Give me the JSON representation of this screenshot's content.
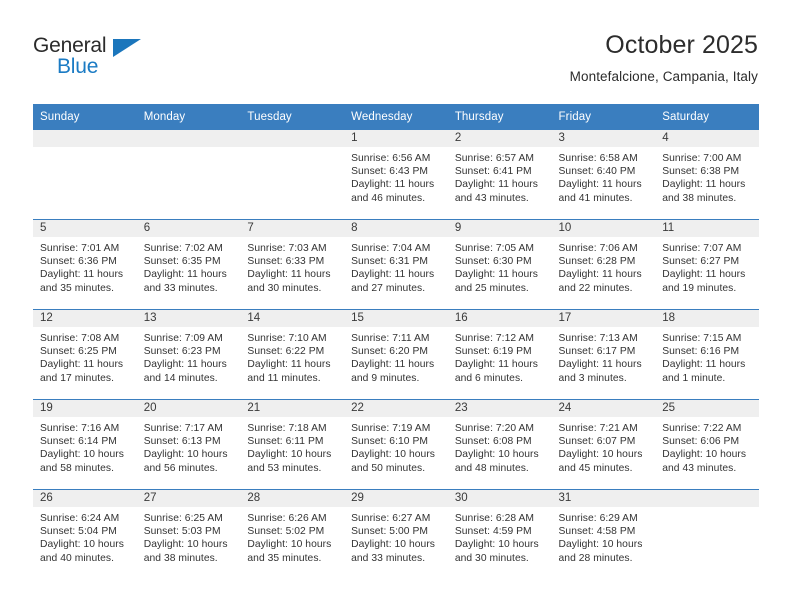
{
  "brand": {
    "name_part1": "General",
    "name_part2": "Blue",
    "accent_color": "#1b76bc"
  },
  "header": {
    "title": "October 2025",
    "location": "Montefalcione, Campania, Italy"
  },
  "calendar": {
    "header_bg": "#3a7ebf",
    "daynum_bg": "#efefef",
    "weekdays": [
      "Sunday",
      "Monday",
      "Tuesday",
      "Wednesday",
      "Thursday",
      "Friday",
      "Saturday"
    ],
    "weeks": [
      [
        {
          "day": "",
          "lines": []
        },
        {
          "day": "",
          "lines": []
        },
        {
          "day": "",
          "lines": []
        },
        {
          "day": "1",
          "lines": [
            "Sunrise: 6:56 AM",
            "Sunset: 6:43 PM",
            "Daylight: 11 hours",
            "and 46 minutes."
          ]
        },
        {
          "day": "2",
          "lines": [
            "Sunrise: 6:57 AM",
            "Sunset: 6:41 PM",
            "Daylight: 11 hours",
            "and 43 minutes."
          ]
        },
        {
          "day": "3",
          "lines": [
            "Sunrise: 6:58 AM",
            "Sunset: 6:40 PM",
            "Daylight: 11 hours",
            "and 41 minutes."
          ]
        },
        {
          "day": "4",
          "lines": [
            "Sunrise: 7:00 AM",
            "Sunset: 6:38 PM",
            "Daylight: 11 hours",
            "and 38 minutes."
          ]
        }
      ],
      [
        {
          "day": "5",
          "lines": [
            "Sunrise: 7:01 AM",
            "Sunset: 6:36 PM",
            "Daylight: 11 hours",
            "and 35 minutes."
          ]
        },
        {
          "day": "6",
          "lines": [
            "Sunrise: 7:02 AM",
            "Sunset: 6:35 PM",
            "Daylight: 11 hours",
            "and 33 minutes."
          ]
        },
        {
          "day": "7",
          "lines": [
            "Sunrise: 7:03 AM",
            "Sunset: 6:33 PM",
            "Daylight: 11 hours",
            "and 30 minutes."
          ]
        },
        {
          "day": "8",
          "lines": [
            "Sunrise: 7:04 AM",
            "Sunset: 6:31 PM",
            "Daylight: 11 hours",
            "and 27 minutes."
          ]
        },
        {
          "day": "9",
          "lines": [
            "Sunrise: 7:05 AM",
            "Sunset: 6:30 PM",
            "Daylight: 11 hours",
            "and 25 minutes."
          ]
        },
        {
          "day": "10",
          "lines": [
            "Sunrise: 7:06 AM",
            "Sunset: 6:28 PM",
            "Daylight: 11 hours",
            "and 22 minutes."
          ]
        },
        {
          "day": "11",
          "lines": [
            "Sunrise: 7:07 AM",
            "Sunset: 6:27 PM",
            "Daylight: 11 hours",
            "and 19 minutes."
          ]
        }
      ],
      [
        {
          "day": "12",
          "lines": [
            "Sunrise: 7:08 AM",
            "Sunset: 6:25 PM",
            "Daylight: 11 hours",
            "and 17 minutes."
          ]
        },
        {
          "day": "13",
          "lines": [
            "Sunrise: 7:09 AM",
            "Sunset: 6:23 PM",
            "Daylight: 11 hours",
            "and 14 minutes."
          ]
        },
        {
          "day": "14",
          "lines": [
            "Sunrise: 7:10 AM",
            "Sunset: 6:22 PM",
            "Daylight: 11 hours",
            "and 11 minutes."
          ]
        },
        {
          "day": "15",
          "lines": [
            "Sunrise: 7:11 AM",
            "Sunset: 6:20 PM",
            "Daylight: 11 hours",
            "and 9 minutes."
          ]
        },
        {
          "day": "16",
          "lines": [
            "Sunrise: 7:12 AM",
            "Sunset: 6:19 PM",
            "Daylight: 11 hours",
            "and 6 minutes."
          ]
        },
        {
          "day": "17",
          "lines": [
            "Sunrise: 7:13 AM",
            "Sunset: 6:17 PM",
            "Daylight: 11 hours",
            "and 3 minutes."
          ]
        },
        {
          "day": "18",
          "lines": [
            "Sunrise: 7:15 AM",
            "Sunset: 6:16 PM",
            "Daylight: 11 hours",
            "and 1 minute."
          ]
        }
      ],
      [
        {
          "day": "19",
          "lines": [
            "Sunrise: 7:16 AM",
            "Sunset: 6:14 PM",
            "Daylight: 10 hours",
            "and 58 minutes."
          ]
        },
        {
          "day": "20",
          "lines": [
            "Sunrise: 7:17 AM",
            "Sunset: 6:13 PM",
            "Daylight: 10 hours",
            "and 56 minutes."
          ]
        },
        {
          "day": "21",
          "lines": [
            "Sunrise: 7:18 AM",
            "Sunset: 6:11 PM",
            "Daylight: 10 hours",
            "and 53 minutes."
          ]
        },
        {
          "day": "22",
          "lines": [
            "Sunrise: 7:19 AM",
            "Sunset: 6:10 PM",
            "Daylight: 10 hours",
            "and 50 minutes."
          ]
        },
        {
          "day": "23",
          "lines": [
            "Sunrise: 7:20 AM",
            "Sunset: 6:08 PM",
            "Daylight: 10 hours",
            "and 48 minutes."
          ]
        },
        {
          "day": "24",
          "lines": [
            "Sunrise: 7:21 AM",
            "Sunset: 6:07 PM",
            "Daylight: 10 hours",
            "and 45 minutes."
          ]
        },
        {
          "day": "25",
          "lines": [
            "Sunrise: 7:22 AM",
            "Sunset: 6:06 PM",
            "Daylight: 10 hours",
            "and 43 minutes."
          ]
        }
      ],
      [
        {
          "day": "26",
          "lines": [
            "Sunrise: 6:24 AM",
            "Sunset: 5:04 PM",
            "Daylight: 10 hours",
            "and 40 minutes."
          ]
        },
        {
          "day": "27",
          "lines": [
            "Sunrise: 6:25 AM",
            "Sunset: 5:03 PM",
            "Daylight: 10 hours",
            "and 38 minutes."
          ]
        },
        {
          "day": "28",
          "lines": [
            "Sunrise: 6:26 AM",
            "Sunset: 5:02 PM",
            "Daylight: 10 hours",
            "and 35 minutes."
          ]
        },
        {
          "day": "29",
          "lines": [
            "Sunrise: 6:27 AM",
            "Sunset: 5:00 PM",
            "Daylight: 10 hours",
            "and 33 minutes."
          ]
        },
        {
          "day": "30",
          "lines": [
            "Sunrise: 6:28 AM",
            "Sunset: 4:59 PM",
            "Daylight: 10 hours",
            "and 30 minutes."
          ]
        },
        {
          "day": "31",
          "lines": [
            "Sunrise: 6:29 AM",
            "Sunset: 4:58 PM",
            "Daylight: 10 hours",
            "and 28 minutes."
          ]
        },
        {
          "day": "",
          "lines": []
        }
      ]
    ]
  }
}
